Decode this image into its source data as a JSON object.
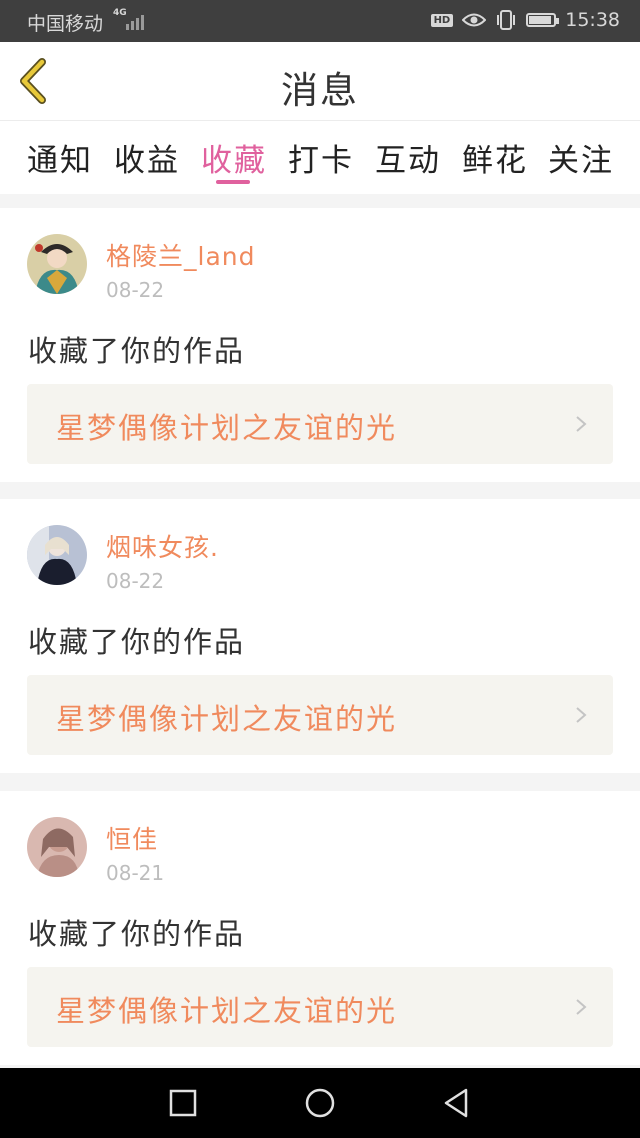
{
  "status_bar": {
    "carrier": "中国移动",
    "network": "4G",
    "hd": "HD",
    "time": "15:38",
    "battery_level": 0.85
  },
  "header": {
    "title": "消息",
    "back_icon": "chevron-left-icon"
  },
  "tabs": [
    {
      "label": "通知",
      "active": false
    },
    {
      "label": "收益",
      "active": false
    },
    {
      "label": "收藏",
      "active": true
    },
    {
      "label": "打卡",
      "active": false
    },
    {
      "label": "互动",
      "active": false
    },
    {
      "label": "鲜花",
      "active": false
    },
    {
      "label": "关注",
      "active": false
    }
  ],
  "messages": [
    {
      "username": "格陵兰_land",
      "date": "08-22",
      "action": "收藏了你的作品",
      "work_title": "星梦偶像计划之友谊的光"
    },
    {
      "username": "烟味女孩.",
      "date": "08-22",
      "action": "收藏了你的作品",
      "work_title": "星梦偶像计划之友谊的光"
    },
    {
      "username": "恒佳",
      "date": "08-21",
      "action": "收藏了你的作品",
      "work_title": "星梦偶像计划之友谊的光"
    }
  ],
  "colors": {
    "accent_pink": "#e0619e",
    "username_orange": "#f08a5d",
    "back_arrow_yellow": "#e8c93a"
  },
  "nav_bar": {
    "icons": [
      "square-recents-icon",
      "circle-home-icon",
      "triangle-back-icon"
    ]
  }
}
